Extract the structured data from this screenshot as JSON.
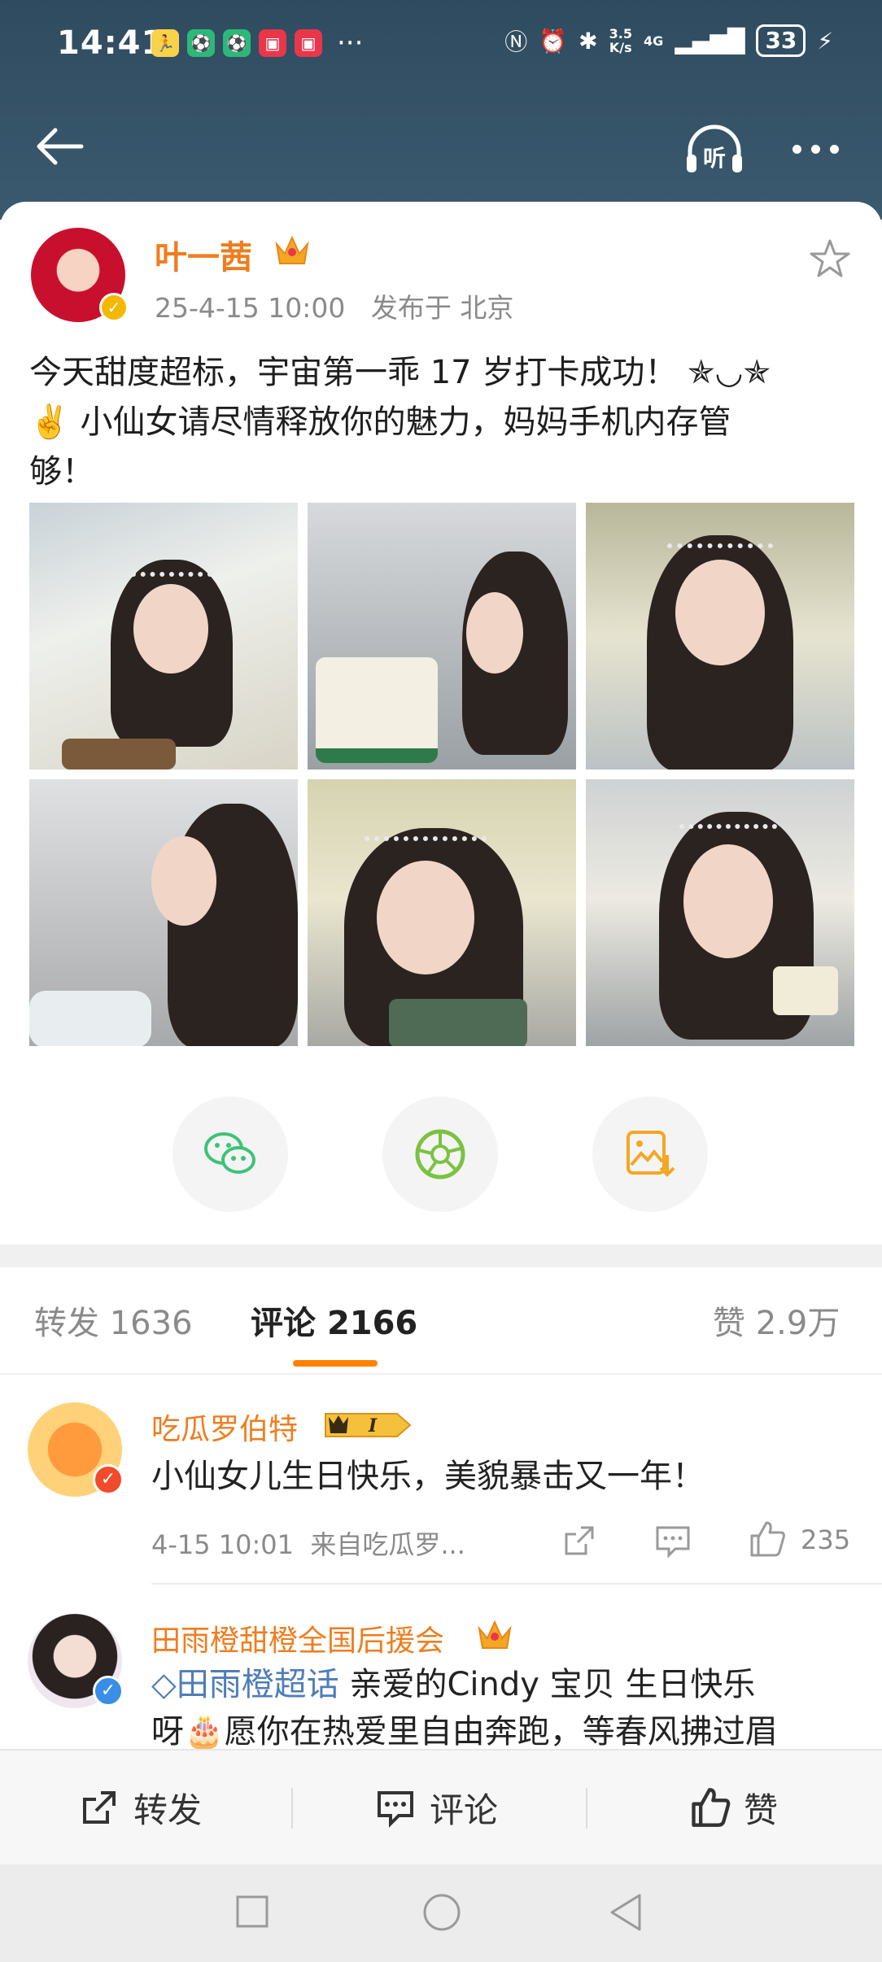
{
  "status_bar": {
    "time": "14:41",
    "speed_top": "3.5",
    "speed_bottom": "K/s",
    "network": "4G",
    "battery": "33",
    "more": "···"
  },
  "header": {
    "back_icon": "arrow-left-icon",
    "listen_label": "听",
    "more_icon": "more-dots-icon"
  },
  "post": {
    "author": "叶一茜",
    "timestamp": "25-4-15 10:00",
    "location": "发布于 北京",
    "text_line1": "今天甜度超标，宇宙第一乖 17 岁打卡成功！ ✯◡✯",
    "text_line2": "✌️ 小仙女请尽情释放你的魅力，妈妈手机内存管",
    "text_line3": "够！",
    "photo_count": 6
  },
  "share_buttons": [
    "wechat-icon",
    "moments-icon",
    "save-image-icon"
  ],
  "tabs": {
    "repost_label": "转发",
    "repost_count": "1636",
    "comment_label": "评论",
    "comment_count": "2166",
    "like_label": "赞",
    "like_count": "2.9万"
  },
  "comments": [
    {
      "name": "吃瓜罗伯特",
      "badge": "I",
      "text": "小仙女儿生日快乐，美貌暴击又一年！",
      "time": "4-15 10:01",
      "source": "来自吃瓜罗...",
      "likes": "235"
    },
    {
      "name": "田雨橙甜橙全国后援会",
      "topic": "田雨橙超话",
      "text_line1": " 亲爱的Cindy 宝贝 生日快乐",
      "text_line2": "呀🎂愿你在热爱里自由奔跑，等春风拂过眉"
    }
  ],
  "bottom_bar": {
    "repost": "转发",
    "comment": "评论",
    "like": "赞"
  },
  "colors": {
    "header_bg": "#2f4b5f",
    "accent_orange": "#ef7d1f",
    "tab_underline": "#ff8200",
    "wechat_green": "#3ec27a",
    "save_orange": "#f5a623"
  }
}
